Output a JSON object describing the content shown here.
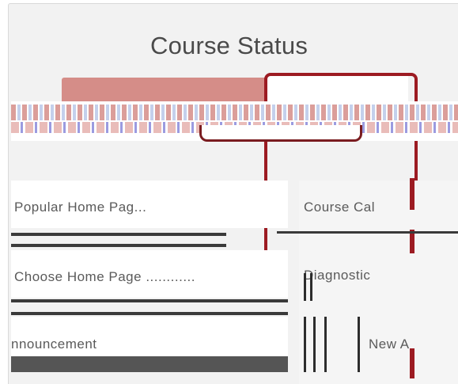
{
  "panel": {
    "title": "Course Status"
  },
  "buttons": {
    "left_label": "",
    "right_label": ""
  },
  "rows": {
    "row1_left": "Popular Home Pag...",
    "row2_left": "Choose Home Page ............",
    "row3_left": "nnouncement",
    "row1_right": "Course Cal",
    "row2_right": "Diagnostic",
    "row3_right": "New A"
  },
  "colors": {
    "panel_bg": "#f2f2f2",
    "accent_red": "#9c1b22",
    "button_pink": "#d58d88"
  }
}
